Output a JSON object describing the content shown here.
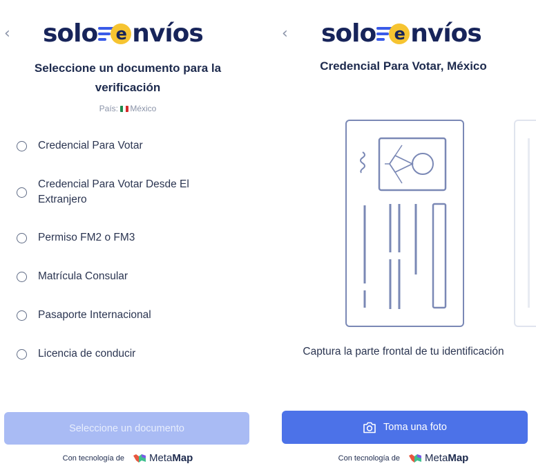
{
  "left": {
    "back_icon": "chevron-left-icon",
    "logo": {
      "part1": "solo",
      "e": "e",
      "part2": "nvíos"
    },
    "title_line1": "Seleccione un documento para la",
    "title_line2": "verificación",
    "country_label": "País:",
    "country_value": "México",
    "options": [
      "Credencial Para Votar",
      "Credencial Para Votar Desde El Extranjero",
      "Permiso FM2 o FM3",
      "Matrícula Consular",
      "Pasaporte Internacional",
      "Licencia de conducir"
    ],
    "button_label": "Seleccione un documento",
    "powered_by": "Con tecnología de",
    "brand_part1": "Meta",
    "brand_part2": "Map"
  },
  "right": {
    "back_icon": "chevron-left-icon",
    "logo": {
      "part1": "solo",
      "e": "e",
      "part2": "nvíos"
    },
    "title": "Credencial Para Votar, México",
    "caption": "Captura la parte frontal de tu identificación",
    "button_label": "Toma una foto",
    "button_icon": "camera-icon",
    "powered_by": "Con tecnología de",
    "brand_part1": "Meta",
    "brand_part2": "Map"
  },
  "colors": {
    "brand_navy": "#17245a",
    "brand_yellow": "#f6c431",
    "accent_blue": "#4c72e8",
    "disabled_blue": "#a9bbf4"
  }
}
